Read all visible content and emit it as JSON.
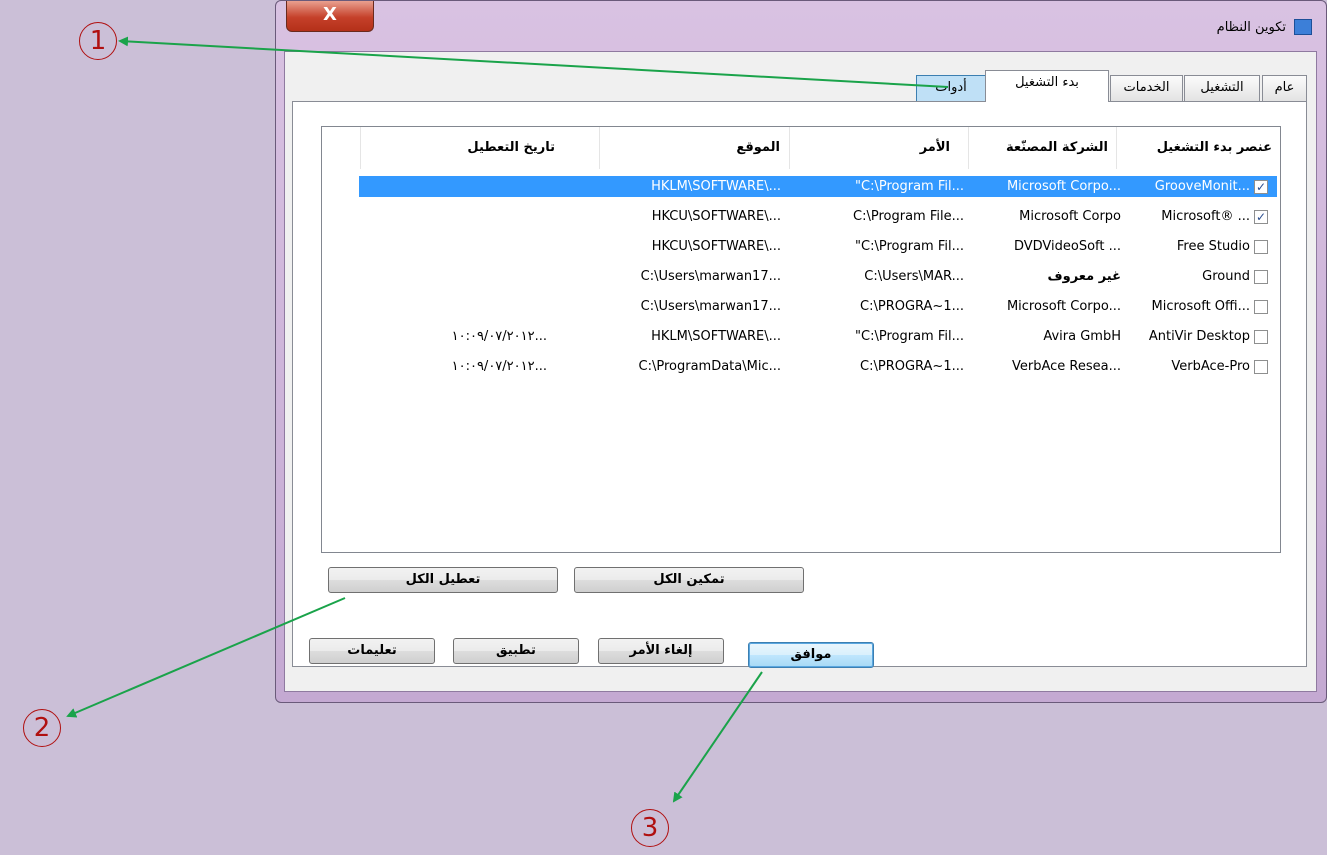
{
  "window": {
    "title": "تكوين النظام",
    "close_glyph": "X"
  },
  "tabs": [
    {
      "label": "عام"
    },
    {
      "label": "التشغيل"
    },
    {
      "label": "الخدمات"
    },
    {
      "label": "بدء التشغيل"
    },
    {
      "label": "أدوات"
    }
  ],
  "list": {
    "columns": [
      "عنصر بدء التشغيل",
      "الشركة المصنّعة",
      "الأمر",
      "الموقع",
      "تاريخ التعطيل"
    ],
    "rows": [
      {
        "checked": true,
        "item": "GrooveMonit...",
        "maker": "Microsoft Corpo...",
        "command": "\"C:\\Program Fil...",
        "location": "HKLM\\SOFTWARE\\...",
        "date": "",
        "selected": true
      },
      {
        "checked": true,
        "item": "Microsoft® ...",
        "maker": "Microsoft Corpo",
        "command": "C:\\Program File...",
        "location": "HKCU\\SOFTWARE\\...",
        "date": "",
        "selected": false
      },
      {
        "checked": false,
        "item": "Free Studio",
        "maker": "DVDVideoSoft ...",
        "command": "\"C:\\Program Fil...",
        "location": "HKCU\\SOFTWARE\\...",
        "date": "",
        "selected": false
      },
      {
        "checked": false,
        "item": "Ground",
        "maker": "غير معروف",
        "command": "C:\\Users\\MAR...",
        "location": "C:\\Users\\marwan17...",
        "date": "",
        "selected": false
      },
      {
        "checked": false,
        "item": "Microsoft Offi...",
        "maker": "Microsoft Corpo...",
        "command": "C:\\PROGRA~1...",
        "location": "C:\\Users\\marwan17...",
        "date": "",
        "selected": false
      },
      {
        "checked": false,
        "item": "AntiVir Desktop",
        "maker": "Avira GmbH",
        "command": "\"C:\\Program Fil...",
        "location": "HKLM\\SOFTWARE\\...",
        "date": "١٠:٠٩/٠٧/٢٠١٢...",
        "selected": false
      },
      {
        "checked": false,
        "item": "VerbAce-Pro",
        "maker": "VerbAce Resea...",
        "command": "C:\\PROGRA~1...",
        "location": "C:\\ProgramData\\Mic...",
        "date": "١٠:٠٩/٠٧/٢٠١٢...",
        "selected": false
      }
    ]
  },
  "buttons": {
    "enable_all": "تمكين الكل",
    "disable_all": "تعطيل الكل",
    "ok": "موافق",
    "cancel": "إلغاء الأمر",
    "apply": "تطبيق",
    "help": "تعليمات"
  },
  "callouts": [
    "1",
    "2",
    "3"
  ],
  "colors": {
    "arrow": "#1aa34a",
    "callout": "#b01010",
    "selection": "#3399ff"
  }
}
